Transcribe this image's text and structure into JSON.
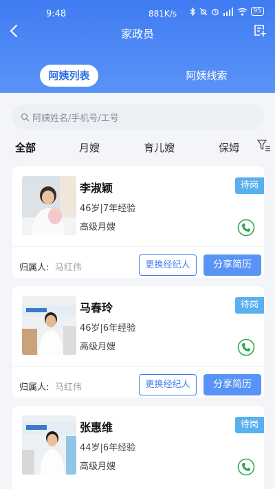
{
  "status_bar": {
    "time": "9:48",
    "network": "881K/s",
    "battery": "95"
  },
  "navbar": {
    "title": "家政员"
  },
  "tabs": [
    {
      "label": "阿姨列表",
      "active": true
    },
    {
      "label": "阿姨线索",
      "active": false
    }
  ],
  "search": {
    "placeholder": "阿姨姓名/手机号/工号"
  },
  "filters": [
    {
      "label": "全部",
      "active": true
    },
    {
      "label": "月嫂",
      "active": false
    },
    {
      "label": "育儿嫂",
      "active": false
    },
    {
      "label": "保姆",
      "active": false
    }
  ],
  "workers": [
    {
      "name": "李淑颖",
      "meta": "46岁|7年经验",
      "level": "高级月嫂",
      "status": "待岗",
      "owner_label": "归属人:",
      "owner": "马红伟",
      "change_label": "更换经纪人",
      "share_label": "分享简历"
    },
    {
      "name": "马春玲",
      "meta": "46岁|6年经验",
      "level": "高级月嫂",
      "status": "待岗",
      "owner_label": "归属人:",
      "owner": "马红伟",
      "change_label": "更换经纪人",
      "share_label": "分享简历"
    },
    {
      "name": "张惠维",
      "meta": "44岁|6年经验",
      "level": "高级月嫂",
      "status": "待岗"
    }
  ],
  "colors": {
    "primary": "#3f7cf2",
    "status_badge": "#58b0ee",
    "phone_icon": "#2fa84f"
  }
}
